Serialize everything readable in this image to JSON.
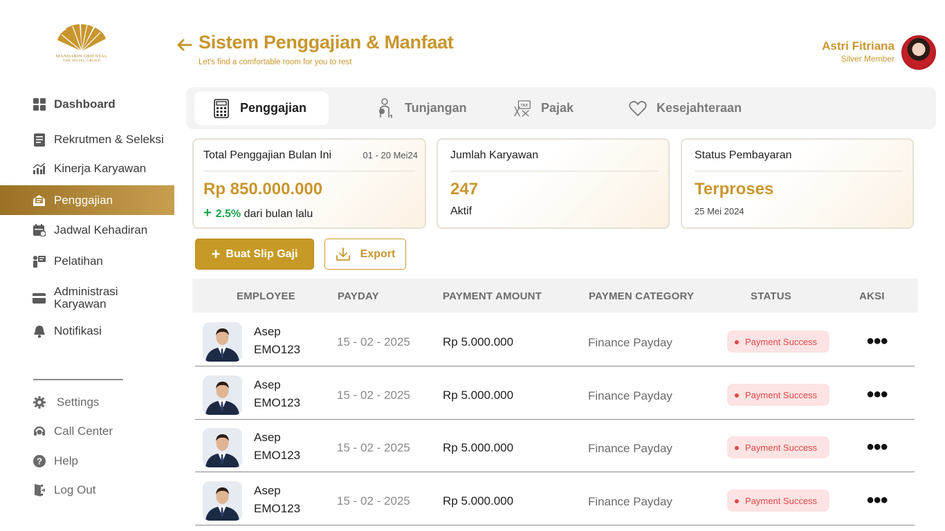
{
  "brand": {
    "line1": "MANDARIN ORIENTAL",
    "line2": "THE HOTEL GROUP"
  },
  "header": {
    "title": "Sistem Penggajian & Manfaat",
    "subtitle": "Let's find a comfortable room for you to rest",
    "user_name": "Astri Fitriana",
    "user_role": "Silver Member"
  },
  "sidebar": {
    "items": [
      {
        "label": "Dashboard",
        "icon": "dashboard-icon"
      },
      {
        "label": "Rekrutmen & Seleksi",
        "icon": "document-icon"
      },
      {
        "label": "Kinerja Karyawan",
        "icon": "chart-icon"
      },
      {
        "label": "Penggajian",
        "icon": "payroll-icon",
        "active": true
      },
      {
        "label": "Jadwal Kehadiran",
        "icon": "calendar-icon"
      },
      {
        "label": "Pelatihan",
        "icon": "training-icon"
      },
      {
        "label": "Administrasi Karyawan",
        "icon": "card-icon"
      },
      {
        "label": "Notifikasi",
        "icon": "bell-icon"
      }
    ],
    "bottom": [
      {
        "label": "Settings",
        "icon": "gear-icon"
      },
      {
        "label": "Call Center",
        "icon": "headset-icon"
      },
      {
        "label": "Help",
        "icon": "help-icon"
      },
      {
        "label": "Log Out",
        "icon": "logout-icon"
      }
    ]
  },
  "tabs": [
    {
      "label": "Penggajian",
      "icon": "calculator-icon",
      "active": true
    },
    {
      "label": "Tunjangan",
      "icon": "allowance-icon"
    },
    {
      "label": "Pajak",
      "icon": "tax-icon"
    },
    {
      "label": "Kesejahteraan",
      "icon": "heart-icon"
    }
  ],
  "cards": {
    "total": {
      "label": "Total Penggajian Bulan Ini",
      "date": "01 - 20 Mei24",
      "value": "Rp 850.000.000",
      "change": "2.5%",
      "change_text": "dari bulan lalu"
    },
    "employees": {
      "label": "Jumlah Karyawan",
      "value": "247",
      "foot": "Aktif"
    },
    "payment": {
      "label": "Status Pembayaran",
      "value": "Terproses",
      "foot": "25 Mei 2024"
    }
  },
  "actions": {
    "create_label": "Buat Slip Gaji",
    "export_label": "Export"
  },
  "table": {
    "headers": [
      "EMPLOYEE",
      "PAYDAY",
      "PAYMENT AMOUNT",
      "PAYMEN CATEGORY",
      "STATUS",
      "AKSI"
    ],
    "rows": [
      {
        "name": "Asep",
        "id": "EMO123",
        "payday": "15 - 02 - 2025",
        "amount": "Rp 5.000.000",
        "category": "Finance Payday",
        "status": "Payment Success"
      },
      {
        "name": "Asep",
        "id": "EMO123",
        "payday": "15 - 02 - 2025",
        "amount": "Rp 5.000.000",
        "category": "Finance Payday",
        "status": "Payment Success"
      },
      {
        "name": "Asep",
        "id": "EMO123",
        "payday": "15 - 02 - 2025",
        "amount": "Rp 5.000.000",
        "category": "Finance Payday",
        "status": "Payment Success"
      },
      {
        "name": "Asep",
        "id": "EMO123",
        "payday": "15 - 02 - 2025",
        "amount": "Rp 5.000.000",
        "category": "Finance Payday",
        "status": "Payment Success"
      }
    ]
  },
  "colors": {
    "accent": "#c8962e",
    "active_nav_start": "#9b7125",
    "active_nav_end": "#c79f4f",
    "success_green": "#1aa34a",
    "status_red": "#e04848"
  }
}
